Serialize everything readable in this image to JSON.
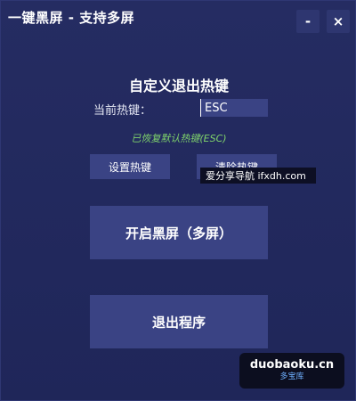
{
  "window": {
    "title": "一键黑屏 - 支持多屏",
    "minimize_label": "-",
    "close_label": "×"
  },
  "hotkey": {
    "heading": "自定义退出热键",
    "current_label": "当前热键：",
    "current_value": "ESC",
    "status": "已恢复默认热键(ESC)",
    "set_label": "设置热键",
    "clear_label": "清除热键"
  },
  "tooltip": {
    "text": "爱分享导航 ifxdh.com"
  },
  "actions": {
    "start_label": "开启黑屏（多屏）",
    "exit_label": "退出程序"
  },
  "watermark": {
    "main": "duobaoku.cn",
    "sub": "多宝库"
  },
  "colors": {
    "background": "#232a5e",
    "button": "#3a4384",
    "status": "#7fd36b"
  }
}
